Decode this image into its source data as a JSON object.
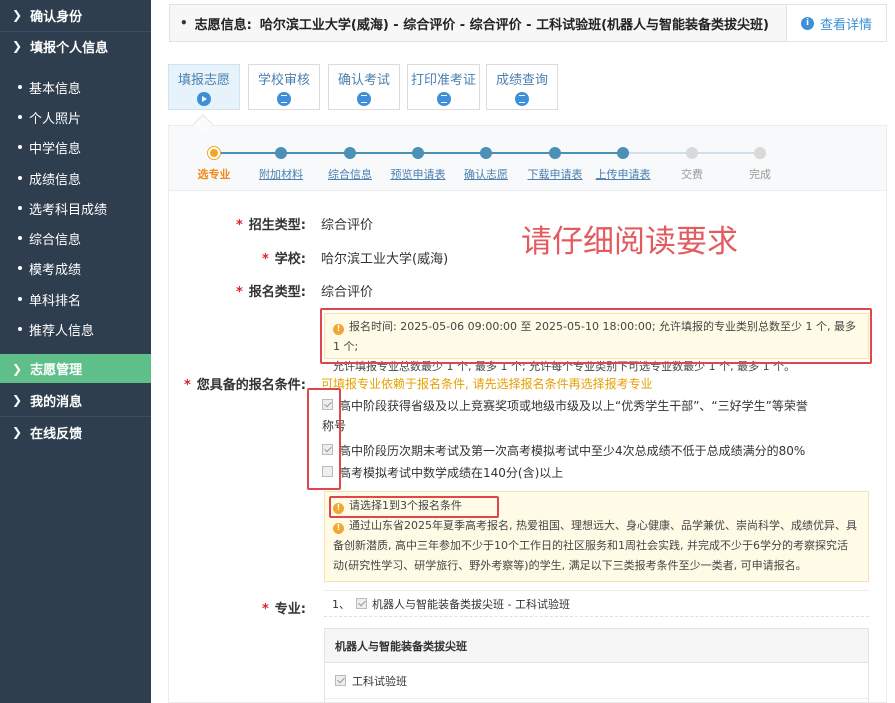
{
  "sidebar": {
    "items": [
      {
        "label": "确认身份"
      },
      {
        "label": "填报个人信息"
      },
      {
        "label": "基本信息"
      },
      {
        "label": "个人照片"
      },
      {
        "label": "中学信息"
      },
      {
        "label": "成绩信息"
      },
      {
        "label": "选考科目成绩"
      },
      {
        "label": "综合信息"
      },
      {
        "label": "模考成绩"
      },
      {
        "label": "单科排名"
      },
      {
        "label": "推荐人信息"
      },
      {
        "label": "志愿管理"
      },
      {
        "label": "我的消息"
      },
      {
        "label": "在线反馈"
      }
    ]
  },
  "info_bar": {
    "bullet": "•",
    "label": "志愿信息:",
    "text": "哈尔滨工业大学(威海) - 综合评价 - 综合评价 - 工科试验班(机器人与智能装备类拔尖班)",
    "detail_icon": "i",
    "detail_label": "查看详情"
  },
  "tabs": [
    {
      "label": "填报志愿",
      "icon": "play-icon"
    },
    {
      "label": "学校审核",
      "icon": "hourglass-icon"
    },
    {
      "label": "确认考试",
      "icon": "hourglass-icon"
    },
    {
      "label": "打印准考证",
      "icon": "hourglass-icon"
    },
    {
      "label": "成绩查询",
      "icon": "hourglass-icon"
    }
  ],
  "steps": [
    {
      "label": "选专业",
      "state": "current"
    },
    {
      "label": "附加材料",
      "state": "done"
    },
    {
      "label": "综合信息",
      "state": "done"
    },
    {
      "label": "预览申请表",
      "state": "done"
    },
    {
      "label": "确认志愿",
      "state": "done"
    },
    {
      "label": "下载申请表",
      "state": "done"
    },
    {
      "label": "上传申请表",
      "state": "done"
    },
    {
      "label": "交费",
      "state": "todo"
    },
    {
      "label": "完成",
      "state": "todo"
    }
  ],
  "form": {
    "req_mark": "*",
    "enroll_type_label": "招生类型:",
    "enroll_type_value": "综合评价",
    "school_label": "学校:",
    "school_value": "哈尔滨工业大学(威海)",
    "apply_type_label": "报名类型:",
    "apply_type_value": "综合评价",
    "big_note": "请仔细阅读要求",
    "time_notice_line1": "报名时间: 2025-05-06 09:00:00 至 2025-05-10 18:00:00; 允许填报的专业类别总数至少 1 个, 最多 1 个;",
    "time_notice_line2": "允许填报专业总数最少 1 个, 最多 1 个; 允许每个专业类别下可选专业数最少 1 个, 最多 1 个。",
    "conditions_label": "您具备的报名条件:",
    "conditions_hint": "可填报专业依赖于报名条件, 请先选择报名条件再选择报考专业",
    "conditions": [
      {
        "text": "高中阶段获得省级及以上竞赛奖项或地级市级及以上“优秀学生干部”、“三好学生”等荣誉",
        "text2": "称号",
        "checked": true
      },
      {
        "text": "高中阶段历次期末考试及第一次高考模拟考试中至少4次总成绩不低于总成绩满分的80%",
        "checked": true
      },
      {
        "text": "高考模拟考试中数学成绩在140分(含)以上",
        "checked": false
      }
    ],
    "select_tip": "请选择1到3个报名条件",
    "eligibility_line1": "通过山东省2025年夏季高考报名, 热爱祖国、理想远大、身心健康、品学兼优、崇尚科学、成绩优异、具",
    "eligibility_line2": "备创新潜质, 高中三年参加不少于10个工作日的社区服务和1周社会实践, 并完成不少于6学分的考察探究活",
    "eligibility_line3": "动(研究性学习、研学旅行、野外考察等)的学生, 满足以下三类报考条件至少一类者, 可申请报名。",
    "major_label": "专业:",
    "major_index": "1、",
    "major_value": "机器人与智能装备类拔尖班 - 工科试验班",
    "major_table_header": "机器人与智能装备类拔尖班",
    "major_table_row": "工科试验班"
  },
  "colors": {
    "sidebar_bg": "#2f3e4e",
    "sidebar_active": "#5fbf88",
    "accent_blue": "#3d8fd6",
    "warning_red": "#e0474c",
    "note_red": "#e45b5f",
    "hint_orange": "#e6a000"
  }
}
